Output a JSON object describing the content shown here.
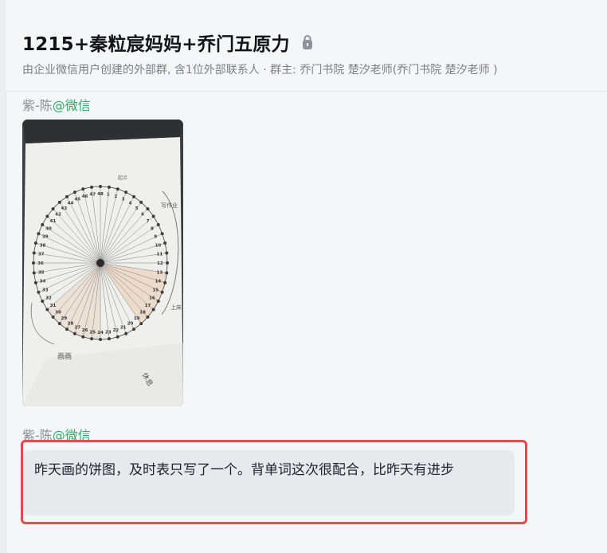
{
  "header": {
    "title": "1215+秦粒宸妈妈+乔门五原力",
    "subtitle": "由企业微信用户创建的外部群, 含1位外部联系人 · 群主: 乔门书院 楚汐老师(乔门书院 楚汐老师 )",
    "title_icon": "lock-icon"
  },
  "messages": [
    {
      "sender_name": "紫-陈",
      "sender_source": "@微信",
      "type": "image"
    },
    {
      "sender_name": "紫-陈",
      "sender_source": "@微信",
      "type": "text",
      "text": "昨天画的饼图，及时表只写了一个。背单词这次很配合，比昨天有进步"
    }
  ],
  "image_content": {
    "label_top": "起点",
    "label_right": "写作业",
    "label_right2": "上床",
    "label_bottom_left": "画画",
    "label_bottom_right": "休息",
    "wheel_numbers": [
      "1",
      "2",
      "3",
      "4",
      "5",
      "6",
      "7",
      "8",
      "9",
      "10",
      "11",
      "12",
      "13",
      "14",
      "15",
      "16",
      "17",
      "18",
      "19",
      "20",
      "21",
      "22",
      "23",
      "24",
      "25",
      "26",
      "27",
      "28",
      "29",
      "30",
      "31",
      "32",
      "33",
      "34",
      "35",
      "36",
      "37",
      "38",
      "39",
      "40",
      "41",
      "42",
      "43",
      "44",
      "45",
      "46",
      "47",
      "48"
    ]
  },
  "colors": {
    "accent_green": "#2aae67",
    "highlight_red": "#e5484d",
    "bubble_bg": "#e7e9ec"
  }
}
